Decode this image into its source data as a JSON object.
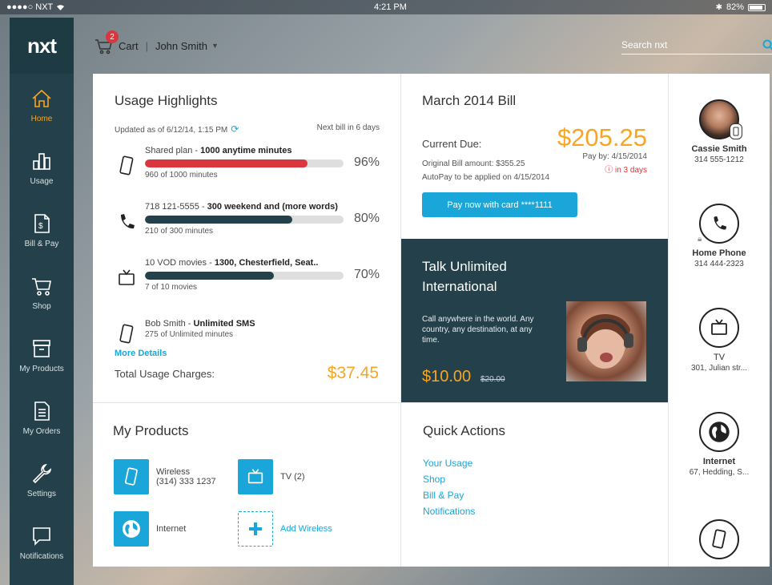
{
  "statusbar": {
    "carrier": "●●●●○ NXT",
    "time": "4:21 PM",
    "battery": "82%"
  },
  "brand": {
    "logo": "nxt",
    "accent": "#1aa6d8",
    "highlight": "#f6a623",
    "dark": "#24404a"
  },
  "sidebar": {
    "items": [
      {
        "label": "Home",
        "icon": "home-icon",
        "active": true
      },
      {
        "label": "Usage",
        "icon": "usage-chart-icon"
      },
      {
        "label": "Bill & Pay",
        "icon": "bill-icon"
      },
      {
        "label": "Shop",
        "icon": "cart-icon"
      },
      {
        "label": "My Products",
        "icon": "box-icon"
      },
      {
        "label": "My Orders",
        "icon": "document-icon"
      },
      {
        "label": "Settings",
        "icon": "wrench-icon"
      },
      {
        "label": "Notifications",
        "icon": "chat-icon"
      }
    ]
  },
  "header": {
    "cart_label": "Cart",
    "cart_count": "2",
    "user": "John Smith",
    "search_placeholder": "Search nxt"
  },
  "usage": {
    "title": "Usage Highlights",
    "updated": "Updated as of 6/12/14, 1:15 PM",
    "next_bill": "Next bill in 6 days",
    "rows": [
      {
        "icon": "mobile-icon",
        "prefix": "Shared plan - ",
        "bold": "1000 anytime minutes",
        "sub": "960 of 1000 minutes",
        "pct": "96%",
        "fill": 0.82,
        "color": "#d9363e"
      },
      {
        "icon": "phone-icon",
        "prefix": "718 121-5555 - ",
        "bold": "300 weekend and (more words)",
        "sub": "210 of 300 minutes",
        "pct": "80%",
        "fill": 0.74,
        "color": "#24404a"
      },
      {
        "icon": "tv-icon",
        "prefix": "10 VOD movies - ",
        "bold": "1300, Chesterfield, Seat..",
        "sub": "7 of 10 movies",
        "pct": "70%",
        "fill": 0.65,
        "color": "#24404a"
      },
      {
        "icon": "mobile-icon",
        "prefix": "Bob Smith - ",
        "bold": "Unlimited SMS",
        "sub": "275 of Unlimited minutes"
      }
    ],
    "more": "More Details",
    "total_label": "Total Usage Charges:",
    "total": "$37.45"
  },
  "bill": {
    "title": "March 2014 Bill",
    "current_label": "Current Due:",
    "amount": "$205.25",
    "pay_by": "Pay by: 4/15/2014",
    "due_in": "in 3 days",
    "original": "Original Bill amount: $355.25",
    "autopay": "AutoPay to be applied on 4/15/2014",
    "pay_button": "Pay now with card ****1111"
  },
  "promo": {
    "title": "Talk Unlimited International",
    "body": "Call anywhere in the world. Any country, any destination, at any time.",
    "price": "$10.00",
    "old_price": "$20.00"
  },
  "products": {
    "title": "My Products",
    "items": [
      {
        "name": "Wireless",
        "detail": "(314) 333 1237",
        "icon": "mobile-icon"
      },
      {
        "name": "TV (2)",
        "icon": "tv-icon"
      },
      {
        "name": "Internet",
        "icon": "globe-icon"
      },
      {
        "name": "Add Wireless",
        "icon": "plus-icon"
      }
    ]
  },
  "quick": {
    "title": "Quick Actions",
    "links": [
      "Your Usage",
      "Shop",
      "Bill & Pay",
      "Notifications"
    ]
  },
  "contacts": [
    {
      "name": "Cassie Smith",
      "detail": "314 555-1212",
      "icon": "avatar"
    },
    {
      "name": "Home Phone",
      "detail": "314 444-2323",
      "icon": "phone-icon"
    },
    {
      "name": "TV",
      "detail": "301, Julian str...",
      "icon": "tv-icon"
    },
    {
      "name": "Internet",
      "detail": "67, Hedding, S...",
      "icon": "globe-icon"
    },
    {
      "icon": "mobile-icon"
    }
  ]
}
